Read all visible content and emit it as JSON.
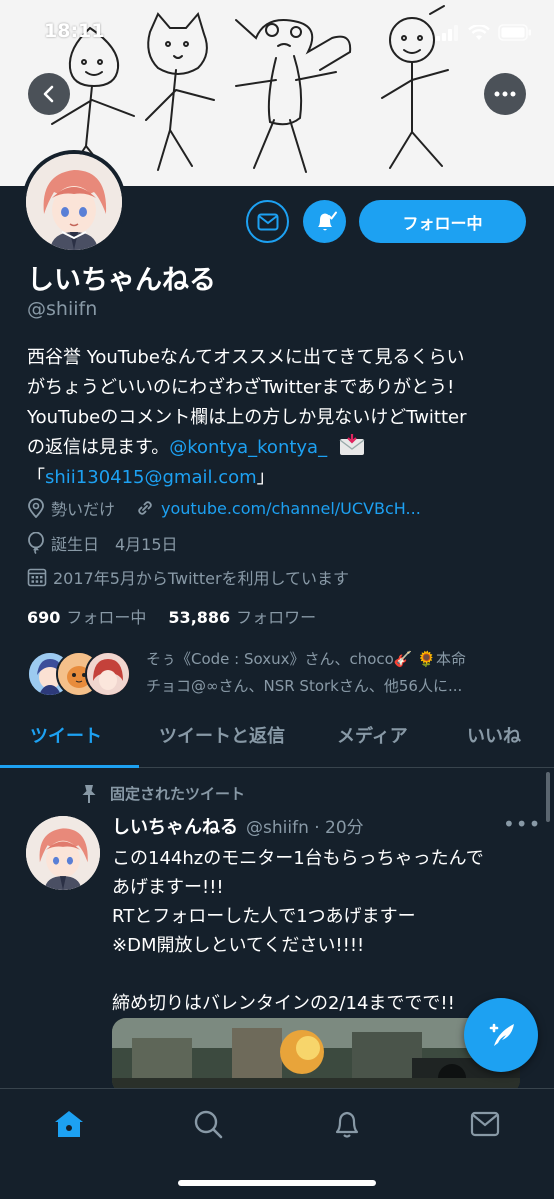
{
  "status_bar": {
    "time": "18:11"
  },
  "profile": {
    "display_name": "しいちゃんねる",
    "handle": "@shiifn",
    "follow_button_label": "フォロー中",
    "bio_line1": "西谷誉 YouTubeなんてオススメに出てきて見るくらい",
    "bio_line2": "がちょうどいいのにわざわざTwitterまでありがとう!",
    "bio_line3": "YouTubeのコメント欄は上の方しか見ないけどTwitter",
    "bio_line4_text": "の返信は見ます。",
    "bio_mention": "@kontya_kontya_",
    "bio_line5_open": "「",
    "bio_email": "shii130415@gmail.com",
    "bio_line5_close": "」",
    "location": "勢いだけ",
    "website": "youtube.com/channel/UCVBcH...",
    "birthday": "誕生日　4月15日",
    "joined": "2017年5月からTwitterを利用しています",
    "following_count": "690",
    "following_label": "フォロー中",
    "followers_count": "53,886",
    "followers_label": "フォロワー",
    "followed_by_line1": "そぅ《Code : Soxux》さん、choco🎸 🌻本命",
    "followed_by_line2": "チョコ@∞さん、NSR Storkさん、他56人に..."
  },
  "tabs": [
    {
      "label": "ツイート",
      "active": true
    },
    {
      "label": "ツイートと返信",
      "active": false
    },
    {
      "label": "メディア",
      "active": false
    },
    {
      "label": "いいね",
      "active": false
    }
  ],
  "pinned_tweet": {
    "pinned_label": "固定されたツイート",
    "author_name": "しいちゃんねる",
    "author_handle_time": "@shiifn · 20分",
    "more_label": "•••",
    "text": "この144hzのモニター1台もらっちゃったんで\nあげますー!!!\nRTとフォローした人で1つあげますー\n※DM開放しといてください!!!!\n\n締め切りはバレンタインの2/14まででで!!"
  },
  "colors": {
    "background": "#15202b",
    "accent": "#1da1f2",
    "secondary_text": "#8899a6",
    "divider": "#38444d"
  },
  "icons": {
    "back": "back-arrow-icon",
    "more": "more-dots-icon",
    "mail": "mail-icon",
    "bell": "bell-check-icon",
    "location": "location-pin-icon",
    "link": "link-icon",
    "balloon": "balloon-icon",
    "calendar": "calendar-icon",
    "pin": "pin-icon",
    "compose": "compose-tweet-icon",
    "home": "home-icon",
    "search": "search-icon",
    "notifications": "notifications-bell-icon",
    "messages": "messages-envelope-icon"
  }
}
